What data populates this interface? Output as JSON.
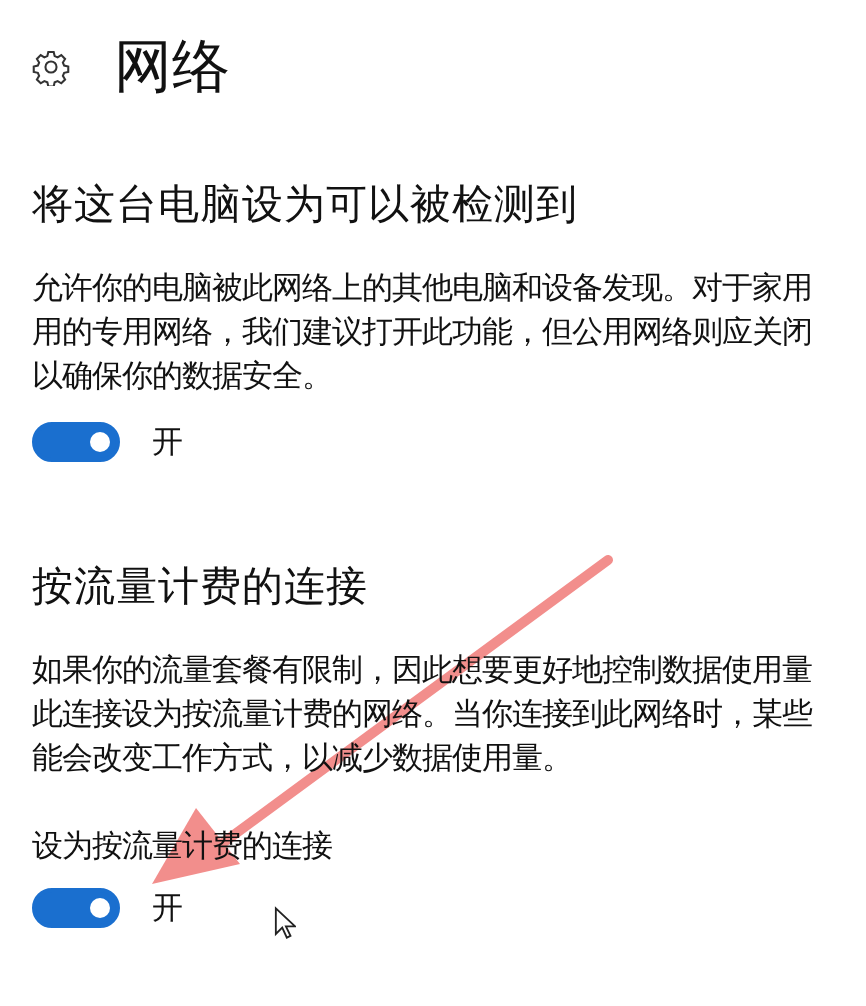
{
  "page": {
    "title": "网络"
  },
  "sections": [
    {
      "heading": "将这台电脑设为可以被检测到",
      "description": "允许你的电脑被此网络上的其他电脑和设备发现。对于家用用的专用网络，我们建议打开此功能，但公用网络则应关闭以确保你的数据安全。",
      "toggle": {
        "on": true,
        "state_text": "开"
      }
    },
    {
      "heading": "按流量计费的连接",
      "description": "如果你的流量套餐有限制，因此想要更好地控制数据使用量此连接设为按流量计费的网络。当你连接到此网络时，某些能会改变工作方式，以减少数据使用量。",
      "toggle": {
        "label": "设为按流量计费的连接",
        "on": true,
        "state_text": "开"
      }
    }
  ]
}
